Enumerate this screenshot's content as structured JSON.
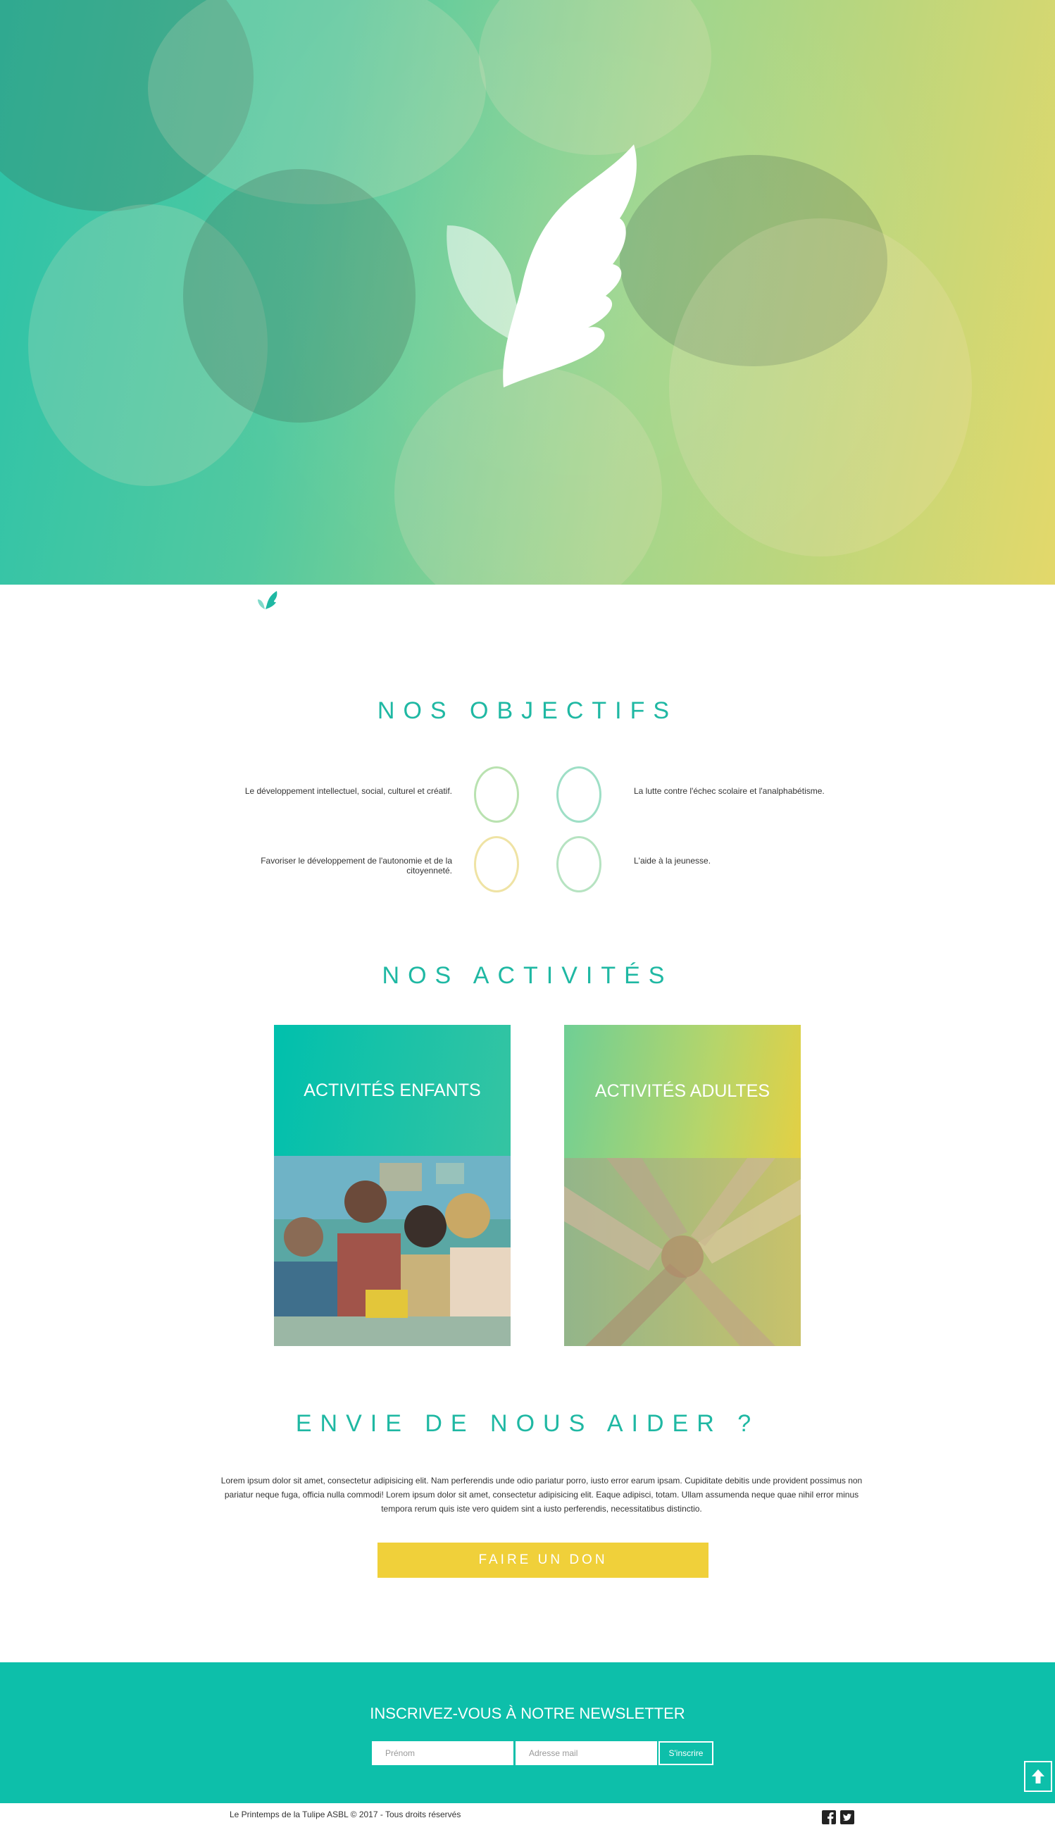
{
  "hero": {
    "logo_icon": "wing-icon",
    "image": "children-circle-photo"
  },
  "small_logo": {
    "icon": "wing-icon"
  },
  "objectives": {
    "title": "NOS OBJECTIFS",
    "items": [
      {
        "text": "Le développement intellectuel, social, culturel et créatif.",
        "circle_color": "#b9e2b0"
      },
      {
        "text": "La lutte contre l'échec scolaire et l'analphabétisme.",
        "circle_color": "#9edfc6"
      },
      {
        "text": "Favoriser le développement de l'autonomie et de la citoyenneté.",
        "circle_color": "#efe3a4"
      },
      {
        "text": "L'aide à la jeunesse.",
        "circle_color": "#b6e3c1"
      }
    ]
  },
  "activities": {
    "title": "NOS ACTIVITÉS",
    "cards": [
      {
        "label": "ACTIVITÉS ENFANTS",
        "image": "children-workshop-photo"
      },
      {
        "label": "ACTIVITÉS ADULTES",
        "image": "hands-together-photo"
      }
    ]
  },
  "help": {
    "title": "ENVIE DE NOUS AIDER ?",
    "text": "Lorem ipsum dolor sit amet, consectetur adipisicing elit. Nam perferendis unde odio pariatur porro, iusto error earum ipsam. Cupiditate debitis unde provident possimus non pariatur neque fuga, officia nulla commodi! Lorem ipsum dolor sit amet, consectetur adipisicing elit. Eaque adipisci, totam. Ullam assumenda neque quae nihil error minus tempora rerum quis iste vero quidem sint a iusto perferendis, necessitatibus distinctio.",
    "button": "FAIRE UN DON"
  },
  "newsletter": {
    "title": "INSCRIVEZ-VOUS À NOTRE NEWSLETTER",
    "firstname_placeholder": "Prénom",
    "email_placeholder": "Adresse mail",
    "submit": "S'inscrire"
  },
  "footer": {
    "copyright": "Le Printemps de la Tulipe ASBL © 2017 - Tous droits réservés",
    "social": [
      "facebook-icon",
      "twitter-icon"
    ]
  },
  "colors": {
    "teal": "#0dbfaa",
    "heading": "#1fb8a3",
    "yellow": "#f0d03a"
  }
}
